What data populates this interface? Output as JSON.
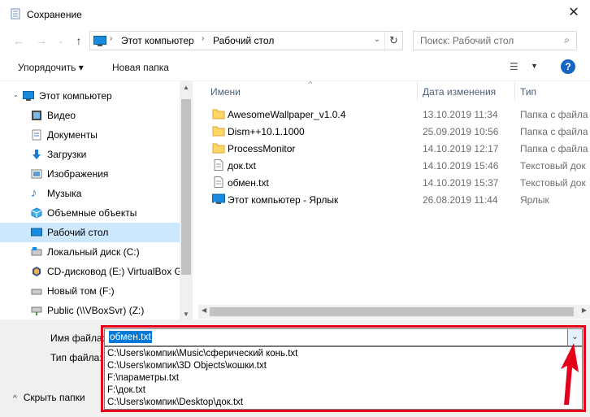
{
  "window": {
    "title": "Сохранение"
  },
  "address": {
    "crumbs": [
      "Этот компьютер",
      "Рабочий стол"
    ]
  },
  "search": {
    "placeholder": "Поиск: Рабочий стол"
  },
  "toolbar": {
    "organize": "Упорядочить ▾",
    "new_folder": "Новая папка"
  },
  "sidebar": {
    "items": [
      {
        "label": "Этот компьютер",
        "icon": "computer-icon"
      },
      {
        "label": "Видео",
        "icon": "video-icon"
      },
      {
        "label": "Документы",
        "icon": "documents-icon"
      },
      {
        "label": "Загрузки",
        "icon": "downloads-icon"
      },
      {
        "label": "Изображения",
        "icon": "pictures-icon"
      },
      {
        "label": "Музыка",
        "icon": "music-icon"
      },
      {
        "label": "Объемные объекты",
        "icon": "3d-objects-icon"
      },
      {
        "label": "Рабочий стол",
        "icon": "desktop-icon",
        "selected": true
      },
      {
        "label": "Локальный диск (C:)",
        "icon": "local-disk-icon"
      },
      {
        "label": "CD-дисковод (E:) VirtualBox Gu",
        "icon": "cd-drive-icon"
      },
      {
        "label": "Новый том (F:)",
        "icon": "drive-icon"
      },
      {
        "label": "Public (\\\\VBoxSvr) (Z:)",
        "icon": "network-drive-icon"
      }
    ]
  },
  "columns": {
    "name": "Имени",
    "date": "Дата изменения",
    "type": "Тип"
  },
  "files": [
    {
      "name": "AwesomeWallpaper_v1.0.4",
      "date": "13.10.2019 11:34",
      "type": "Папка с файла",
      "icon": "folder-icon"
    },
    {
      "name": "Dism++10.1.1000",
      "date": "25.09.2019 10:56",
      "type": "Папка с файла",
      "icon": "folder-icon"
    },
    {
      "name": "ProcessMonitor",
      "date": "14.10.2019 12:17",
      "type": "Папка с файла",
      "icon": "folder-icon"
    },
    {
      "name": "док.txt",
      "date": "14.10.2019 15:46",
      "type": "Текстовый док",
      "icon": "text-file-icon"
    },
    {
      "name": "обмен.txt",
      "date": "14.10.2019 15:37",
      "type": "Текстовый док",
      "icon": "text-file-icon"
    },
    {
      "name": "Этот компьютер - Ярлык",
      "date": "26.08.2019 11:44",
      "type": "Ярлык",
      "icon": "shortcut-icon"
    }
  ],
  "bottom": {
    "filename_label": "Имя файла:",
    "filetype_label": "Тип файла:",
    "filename_value": "обмен.txt",
    "collapse_label": "Скрыть папки"
  },
  "autocomplete": [
    "C:\\Users\\компик\\Music\\сферический конь.txt",
    "C:\\Users\\компик\\3D Objects\\кошки.txt",
    "F:\\параметры.txt",
    "F:\\док.txt",
    "C:\\Users\\компик\\Desktop\\док.txt"
  ],
  "colors": {
    "selection": "#cce8ff",
    "accent": "#0078d7",
    "highlight_frame": "#e3001b"
  }
}
